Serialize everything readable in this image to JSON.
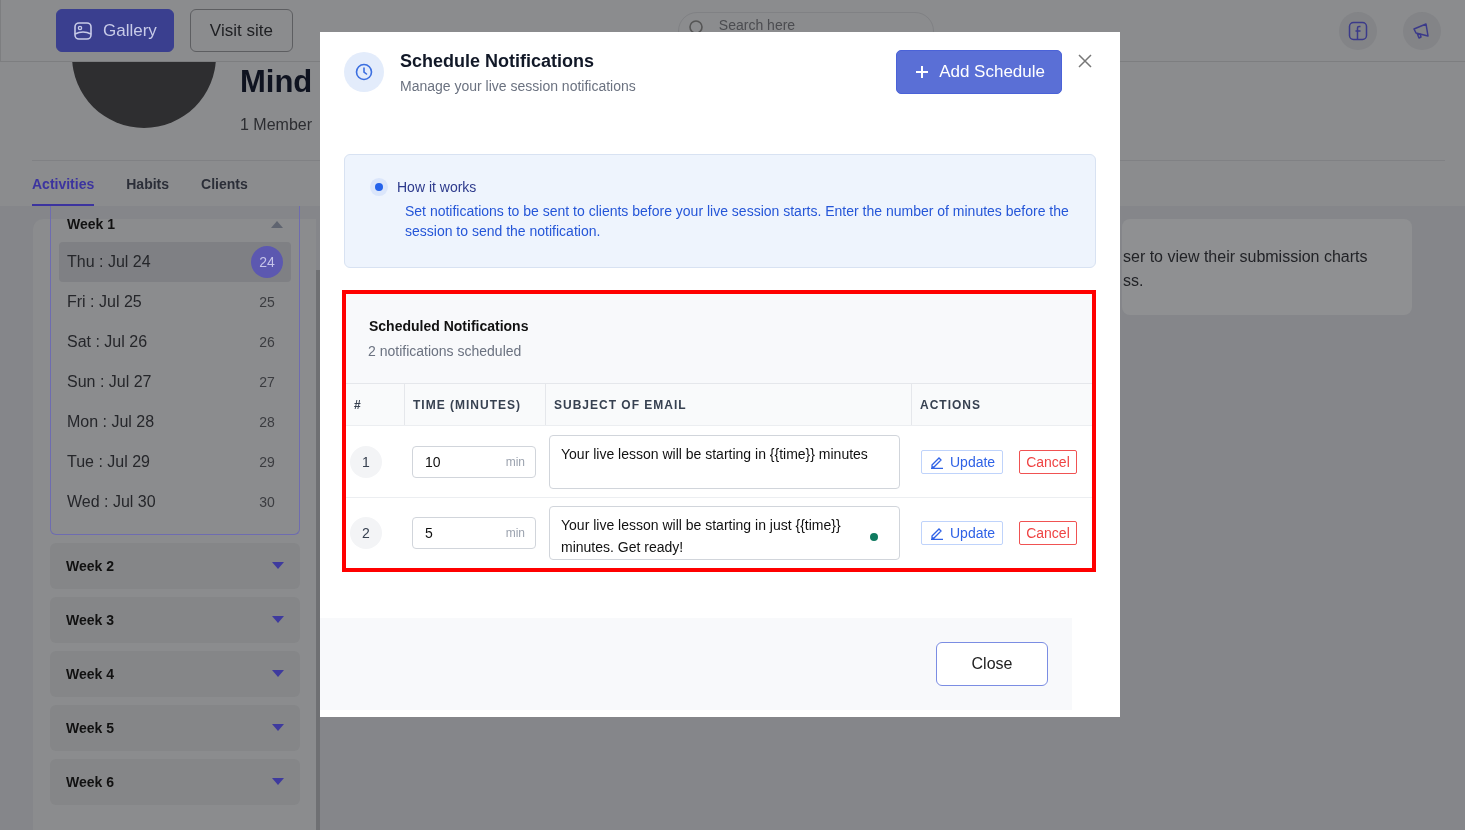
{
  "header": {
    "buttons": [
      {
        "label": "Gallery",
        "kind": "primary"
      },
      {
        "label": "Visit site",
        "kind": "outline"
      }
    ],
    "search": {
      "placeholder": "Search here"
    }
  },
  "profile": {
    "title": "Mind",
    "members": "1 Member"
  },
  "tabs": [
    {
      "label": "Activities",
      "selected": true
    },
    {
      "label": "Habits",
      "selected": false
    },
    {
      "label": "Clients",
      "selected": false
    }
  ],
  "weeks": [
    {
      "label": "Week 1",
      "expanded": true,
      "days": [
        {
          "label": "Thu : Jul 24",
          "count": "24",
          "selected": true
        },
        {
          "label": "Fri : Jul 25",
          "count": "25",
          "selected": false
        },
        {
          "label": "Sat : Jul 26",
          "count": "26",
          "selected": false
        },
        {
          "label": "Sun : Jul 27",
          "count": "27",
          "selected": false
        },
        {
          "label": "Mon : Jul 28",
          "count": "28",
          "selected": false
        },
        {
          "label": "Tue : Jul 29",
          "count": "29",
          "selected": false
        },
        {
          "label": "Wed : Jul 30",
          "count": "30",
          "selected": false
        }
      ]
    },
    {
      "label": "Week 2",
      "expanded": false
    },
    {
      "label": "Week 3",
      "expanded": false
    },
    {
      "label": "Week 4",
      "expanded": false
    },
    {
      "label": "Week 5",
      "expanded": false
    },
    {
      "label": "Week 6",
      "expanded": false
    }
  ],
  "info_card": {
    "lines": [
      "ser to view their submission charts",
      "ss."
    ]
  },
  "modal": {
    "title": "Schedule Notifications",
    "subtitle": "Manage your live session notifications",
    "add_button": "Add Schedule",
    "info": {
      "title": "How it works",
      "text": "Set notifications to be sent to clients before your live session starts. Enter the number of minutes before the session to send the notification."
    },
    "section": {
      "highlighted": true,
      "title": "Scheduled Notifications",
      "count": "2 notifications scheduled",
      "columns": [
        "#",
        "TIME (MINUTES)",
        "SUBJECT OF EMAIL",
        "ACTIONS"
      ],
      "rows": [
        {
          "index": "1",
          "minutes": "10",
          "unit": "min",
          "subject": "Your live lesson will be starting in {{time}} minutes",
          "actions": [
            "Update",
            "Cancel"
          ]
        },
        {
          "index": "2",
          "minutes": "5",
          "unit": "min",
          "subject": "Your live lesson will be starting in just {{time}} minutes. Get ready!",
          "actions": [
            "Update",
            "Cancel"
          ]
        }
      ]
    },
    "close_button": "Close"
  }
}
